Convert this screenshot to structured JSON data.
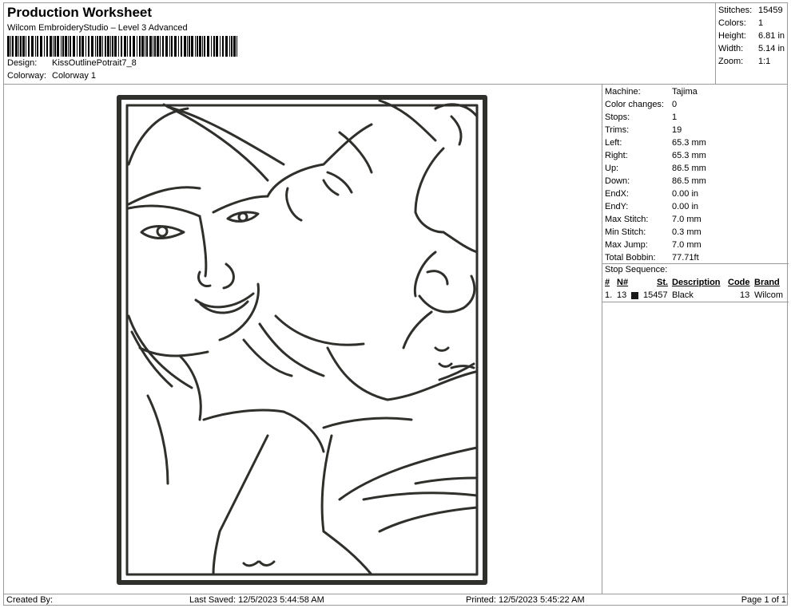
{
  "header": {
    "title": "Production Worksheet",
    "subtitle": "Wilcom EmbroideryStudio – Level 3 Advanced",
    "design_label": "Design:",
    "design_value": "KissOutlinePotrait7_8",
    "colorway_label": "Colorway:",
    "colorway_value": "Colorway 1"
  },
  "summary": [
    {
      "label": "Stitches:",
      "value": "15459"
    },
    {
      "label": "Colors:",
      "value": "1"
    },
    {
      "label": "Height:",
      "value": "6.81 in"
    },
    {
      "label": "Width:",
      "value": "5.14 in"
    },
    {
      "label": "Zoom:",
      "value": "1:1"
    }
  ],
  "properties": [
    {
      "label": "Machine:",
      "value": "Tajima"
    },
    {
      "label": "Color changes:",
      "value": "0"
    },
    {
      "label": "Stops:",
      "value": "1"
    },
    {
      "label": "Trims:",
      "value": "19"
    },
    {
      "label": "Left:",
      "value": "65.3 mm"
    },
    {
      "label": "Right:",
      "value": "65.3 mm"
    },
    {
      "label": "Up:",
      "value": "86.5 mm"
    },
    {
      "label": "Down:",
      "value": "86.5 mm"
    },
    {
      "label": "EndX:",
      "value": "0.00 in"
    },
    {
      "label": "EndY:",
      "value": "0.00 in"
    },
    {
      "label": "Max Stitch:",
      "value": "7.0 mm"
    },
    {
      "label": "Min Stitch:",
      "value": "0.3 mm"
    },
    {
      "label": "Max Jump:",
      "value": "7.0 mm"
    },
    {
      "label": "Total Bobbin:",
      "value": "77.71ft"
    }
  ],
  "stop_sequence": {
    "title": "Stop Sequence:",
    "headers": {
      "num": "#",
      "n": "N#",
      "st": "St.",
      "description": "Description",
      "code": "Code",
      "brand": "Brand"
    },
    "rows": [
      {
        "num": "1.",
        "n": "13",
        "color": "#1a1a1a",
        "st": "15457",
        "description": "Black",
        "code": "13",
        "brand": "Wilcom"
      }
    ]
  },
  "footer": {
    "created_by": "Created By:",
    "last_saved": "Last Saved: 12/5/2023 5:44:58 AM",
    "printed": "Printed: 12/5/2023 5:45:22 AM",
    "page": "Page 1 of 1"
  },
  "design": {
    "thread_color": "#2f2f2b"
  }
}
